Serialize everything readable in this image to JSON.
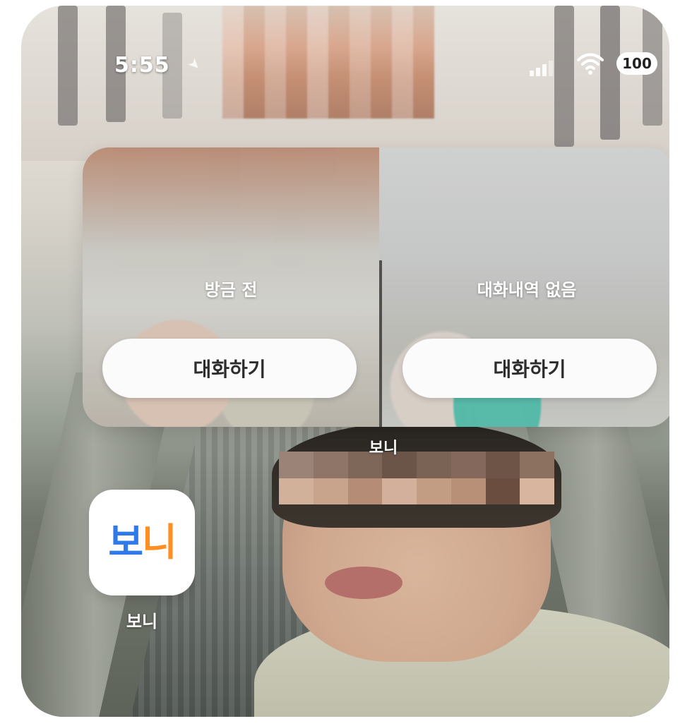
{
  "status_bar": {
    "time": "5:55",
    "location_icon": "location-arrow-icon",
    "signal_icon": "cellular-signal-icon",
    "wifi_icon": "wifi-icon",
    "battery": "100"
  },
  "widget": {
    "cells": [
      {
        "status": "방금 전",
        "button_label": "대화하기"
      },
      {
        "status": "대화내역 없음",
        "button_label": "대화하기"
      }
    ],
    "label": "보니"
  },
  "app": {
    "name": "보니",
    "logo_text": "보니",
    "logo_colors": {
      "primary": "#2f79e8",
      "secondary": "#ff8f23"
    }
  },
  "colors": {
    "status_text": "#ffffff",
    "button_background": "#fbfbfb",
    "button_text": "#2d2d2d"
  }
}
